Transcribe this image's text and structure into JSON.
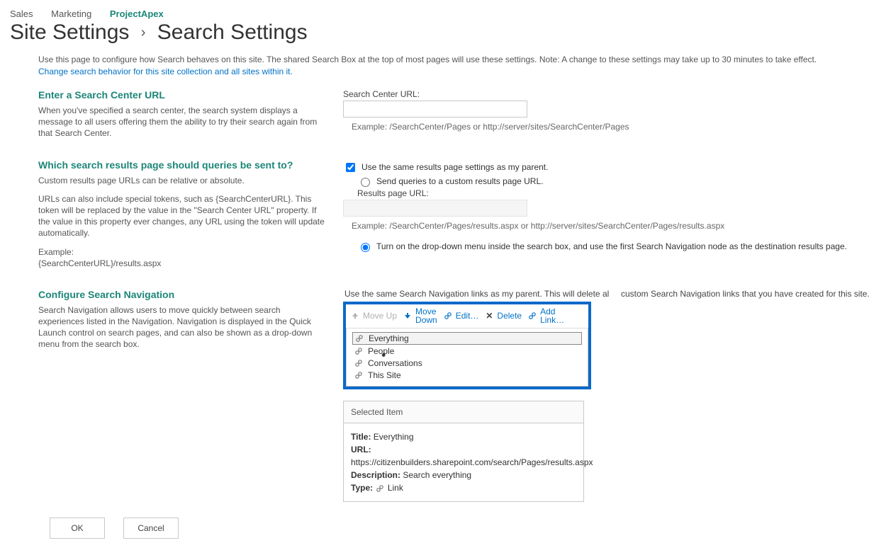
{
  "breadcrumb": {
    "a": "Sales",
    "b": "Marketing",
    "c": "ProjectApex"
  },
  "title": {
    "a": "Site Settings",
    "b": "Search Settings"
  },
  "intro": {
    "text": "Use this page to configure how Search behaves on this site. The shared Search Box at the top of most pages will use these settings. Note: A change to these settings may take up to 30 minutes to take effect.",
    "link": "Change search behavior for this site collection and all sites within it."
  },
  "sec1": {
    "title": "Enter a Search Center URL",
    "body": "When you've specified a search center, the search system displays a message to all users offering them the ability to try their search again from that Search Center.",
    "right_label": "Search Center URL:",
    "hint": "Example: /SearchCenter/Pages or http://server/sites/SearchCenter/Pages"
  },
  "sec2": {
    "title": "Which search results page should queries be sent to?",
    "p1": "Custom results page URLs can be relative or absolute.",
    "p2": "URLs can also include special tokens, such as {SearchCenterURL}. This token will be replaced by the value in the \"Search Center URL\" property. If the value in this property ever changes, any URL using the token will update automatically.",
    "ex_label": "Example:",
    "ex_value": "{SearchCenterURL}/results.aspx",
    "chk": "Use the same results page settings as my parent.",
    "radio1": "Send queries to a custom results page URL.",
    "results_label": "Results page URL:",
    "hint2": "Example: /SearchCenter/Pages/results.aspx or http://server/sites/SearchCenter/Pages/results.aspx",
    "radio2": "Turn on the drop-down menu inside the search box, and use the first Search Navigation node as the destination results page."
  },
  "sec3": {
    "title": "Configure Search Navigation",
    "body": "Search Navigation allows users to move quickly between search experiences listed in the Navigation. Navigation is displayed in the Quick Launch control on search pages, and can also be shown as a drop-down menu from the search box.",
    "parent_line_pre": "Use the same Search Navigation links as my parent. This will delete al",
    "parent_line_post": " custom Search Navigation links that you have created for this site.",
    "tb": {
      "moveup": "Move Up",
      "movedown": "Move\nDown",
      "edit": "Edit…",
      "delete": "Delete",
      "add": "Add\nLink…"
    },
    "items": [
      {
        "label": "Everything"
      },
      {
        "label": "People"
      },
      {
        "label": "Conversations"
      },
      {
        "label": "This Site"
      }
    ],
    "sel": {
      "head": "Selected Item",
      "title_k": "Title:",
      "title_v": "Everything",
      "url_k": "URL:",
      "url_v": "https://citizenbuilders.sharepoint.com/search/Pages/results.aspx",
      "desc_k": "Description:",
      "desc_v": "Search everything",
      "type_k": "Type:",
      "type_v": "Link"
    }
  },
  "buttons": {
    "ok": "OK",
    "cancel": "Cancel"
  }
}
